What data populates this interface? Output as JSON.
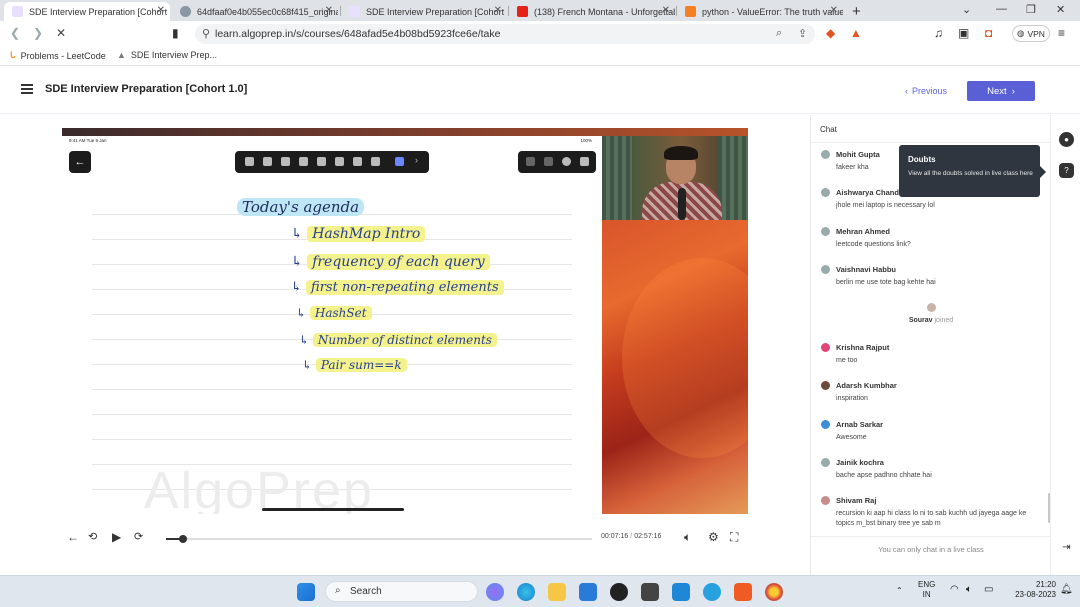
{
  "browser": {
    "tabs": [
      {
        "title": "SDE Interview Preparation [Cohort",
        "active": true
      },
      {
        "title": "64dfaaf0e4b055ec0c68f415_original.p",
        "active": false
      },
      {
        "title": "SDE Interview Preparation [Cohort 1.0",
        "active": false
      },
      {
        "title": "(138) French Montana - Unforgettable",
        "active": false
      },
      {
        "title": "python - ValueError: The truth value of",
        "active": false
      }
    ],
    "url": "learn.algoprep.in/s/courses/648afad5e4b08bd5923fce6e/take",
    "vpn_label": "VPN",
    "bookmarks": [
      "Problems - LeetCode",
      "SDE Interview Prep..."
    ]
  },
  "header": {
    "course_title": "SDE Interview Preparation [Cohort 1.0]",
    "previous_label": "Previous",
    "next_label": "Next"
  },
  "video": {
    "ipad_time": "9:41 AM  Tue 9 Jan",
    "ipad_battery": "100%",
    "agenda_title": "Today's agenda",
    "agenda_items": [
      "HashMap Intro",
      "frequency of each query",
      "first non-repeating elements",
      "HashSet",
      "Number of distinct elements",
      "Pair sum==k"
    ],
    "watermark": "AlgoPrep",
    "current_time": "00:07:16",
    "total_time": "02:57:16",
    "progress_fraction": 0.041
  },
  "chat": {
    "header": "Chat",
    "messages": [
      {
        "name": "Mohit Gupta",
        "text": "fakeer kha"
      },
      {
        "name": "Aishwarya Chand",
        "text": "jhole mei laptop is necessary lol"
      },
      {
        "name": "Mehran Ahmed",
        "text": "leetcode questions link?"
      },
      {
        "name": "Vaishnavi Habbu",
        "text": "berlin me use tote bag kehte hai"
      },
      {
        "name": "Krishna Rajput",
        "text": "me too"
      },
      {
        "name": "Adarsh Kumbhar",
        "text": "inspiration"
      },
      {
        "name": "Arnab Sarkar",
        "text": "Awesome"
      },
      {
        "name": "Jainik kochra",
        "text": "bache apse padhno chhate hai"
      },
      {
        "name": "Shivam Raj",
        "text": "recursion ki aap hi class lo ni to sab kuchh ud jayega aage ke topics m_bst binary tree ye sab m"
      }
    ],
    "joined_user": "Sourav",
    "joined_text": "joined",
    "footer": "You can only chat in a live class"
  },
  "tooltip": {
    "title": "Doubts",
    "body": "View all the doubts solved in live class here"
  },
  "taskbar": {
    "search_label": "Search",
    "language_top": "ENG",
    "language_bottom": "IN",
    "clock_time": "21:20",
    "clock_date": "23-08-2023"
  },
  "colors": {
    "accent": "#5a5fd6",
    "tooltip_bg": "#2f3640",
    "highlight_yellow": "#f3f28c",
    "ink_blue": "#2a3f8f"
  }
}
